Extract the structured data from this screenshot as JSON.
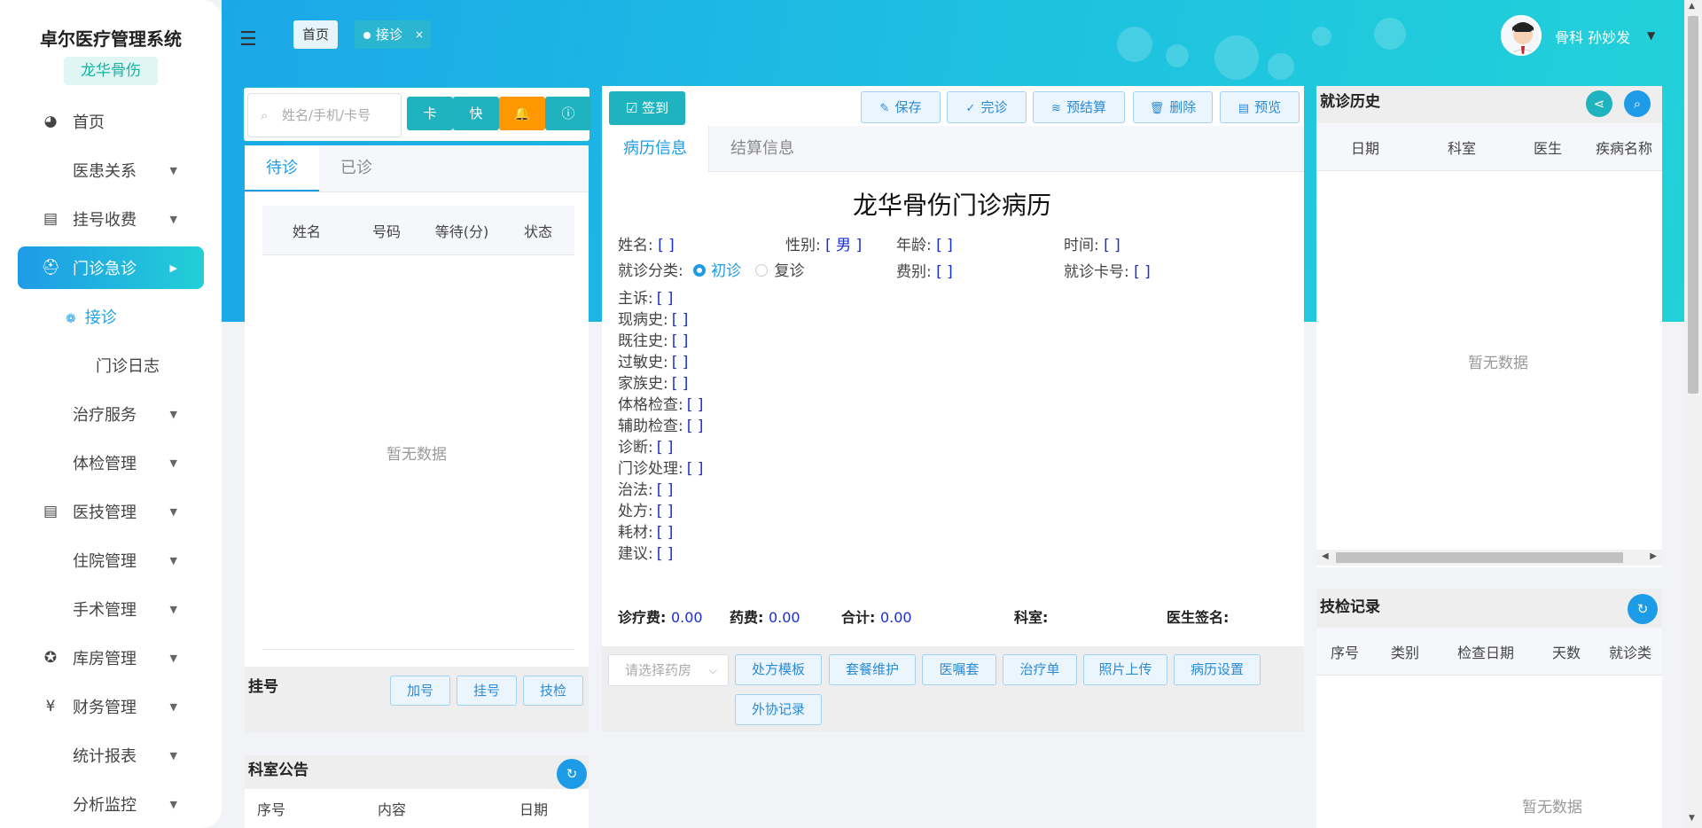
{
  "app": {
    "title": "卓尔医疗管理系统",
    "hospital": "龙华骨伤"
  },
  "sidebar": {
    "items": [
      {
        "label": "首页",
        "icon": "dashboard-icon",
        "glyph": "◕",
        "arrow": ""
      },
      {
        "label": "医患关系",
        "icon": "",
        "glyph": "",
        "arrow": "▼"
      },
      {
        "label": "挂号收费",
        "icon": "calendar-icon",
        "glyph": "▤",
        "arrow": "▼"
      },
      {
        "label": "门诊急诊",
        "icon": "doctor-icon",
        "glyph": "⛑",
        "arrow": "▶"
      },
      {
        "label": "治疗服务",
        "icon": "",
        "glyph": "",
        "arrow": "▼"
      },
      {
        "label": "体检管理",
        "icon": "",
        "glyph": "",
        "arrow": "▼"
      },
      {
        "label": "医技管理",
        "icon": "document-icon",
        "glyph": "▤",
        "arrow": "▼"
      },
      {
        "label": "住院管理",
        "icon": "",
        "glyph": "",
        "arrow": "▼"
      },
      {
        "label": "手术管理",
        "icon": "",
        "glyph": "",
        "arrow": "▼"
      },
      {
        "label": "库房管理",
        "icon": "warehouse-icon",
        "glyph": "✪",
        "arrow": "▼"
      },
      {
        "label": "财务管理",
        "icon": "yen-icon",
        "glyph": "¥",
        "arrow": "▼"
      },
      {
        "label": "统计报表",
        "icon": "",
        "glyph": "",
        "arrow": "▼"
      },
      {
        "label": "分析监控",
        "icon": "",
        "glyph": "",
        "arrow": "▼"
      }
    ],
    "subitems": {
      "reception": "接诊",
      "log": "门诊日志"
    }
  },
  "header": {
    "tabs": {
      "home": "首页",
      "active": "接诊",
      "close": "×"
    },
    "user": "骨科 孙妙发"
  },
  "queue": {
    "search_placeholder": "姓名/手机/卡号",
    "btn_card": "卡",
    "btn_fast": "快",
    "tabs": [
      "待诊",
      "已诊"
    ],
    "columns": [
      "姓名",
      "号码",
      "等待(分)",
      "状态"
    ],
    "empty": "暂无数据"
  },
  "registration": {
    "title": "挂号",
    "buttons": [
      "加号",
      "挂号",
      "技检"
    ]
  },
  "notice": {
    "title": "科室公告",
    "columns": [
      "序号",
      "内容",
      "日期"
    ]
  },
  "toolbar": {
    "sign": "签到",
    "buttons": [
      {
        "label": "保存",
        "glyph": "✎"
      },
      {
        "label": "完诊",
        "glyph": "✓"
      },
      {
        "label": "预结算",
        "glyph": "≋"
      },
      {
        "label": "删除",
        "glyph": "🗑"
      },
      {
        "label": "预览",
        "glyph": "▤"
      }
    ]
  },
  "record": {
    "tabs": [
      "病历信息",
      "结算信息"
    ],
    "title": "龙华骨伤门诊病历",
    "fields": {
      "name": "姓名:",
      "name_val": "[ ]",
      "gender": "性别:",
      "gender_val": "[ 男 ]",
      "age": "年龄:",
      "age_val": "[ ]",
      "time": "时间:",
      "time_val": "[ ]",
      "visit_type": "就诊分类:",
      "first_visit": "初诊",
      "return_visit": "复诊",
      "fee_type": "费别:",
      "fee_type_val": "[ ]",
      "card_no": "就诊卡号:",
      "card_no_val": "[ ]"
    },
    "sections": [
      {
        "label": "主诉:",
        "val": "[ ]"
      },
      {
        "label": "现病史:",
        "val": "[ ]"
      },
      {
        "label": "既往史:",
        "val": "[ ]"
      },
      {
        "label": "过敏史:",
        "val": "[ ]"
      },
      {
        "label": "家族史:",
        "val": "[ ]"
      },
      {
        "label": "体格检查:",
        "val": "[ ]"
      },
      {
        "label": "辅助检查:",
        "val": "[ ]"
      },
      {
        "label": "诊断:",
        "val": "[ ]"
      },
      {
        "label": "门诊处理:",
        "val": "[ ]"
      },
      {
        "label": "治法:",
        "val": "[ ]"
      },
      {
        "label": "处方:",
        "val": "[ ]"
      },
      {
        "label": "耗材:",
        "val": "[ ]"
      },
      {
        "label": "建议:",
        "val": "[ ]"
      }
    ],
    "fees": {
      "treatment_label": "诊疗费:",
      "treatment": "0.00",
      "drug_label": "药费:",
      "drug": "0.00",
      "total_label": "合计:",
      "total": "0.00",
      "dept_label": "科室:",
      "signature_label": "医生签名:"
    }
  },
  "actions": {
    "pharmacy_placeholder": "请选择药房",
    "buttons": [
      "处方模板",
      "套餐维护",
      "医嘱套",
      "治疗单",
      "照片上传",
      "病历设置"
    ],
    "extra": "外协记录"
  },
  "history": {
    "title": "就诊历史",
    "columns": [
      "日期",
      "科室",
      "医生",
      "疾病名称"
    ],
    "empty": "暂无数据"
  },
  "exams": {
    "title": "技检记录",
    "columns": [
      "序号",
      "类别",
      "检查日期",
      "天数",
      "就诊类"
    ],
    "empty": "暂无数据"
  },
  "colors": {
    "accent": "#1e9be6",
    "teal": "#1fb3c0",
    "orange": "#ff9800",
    "value_blue": "#1a2fd0"
  }
}
